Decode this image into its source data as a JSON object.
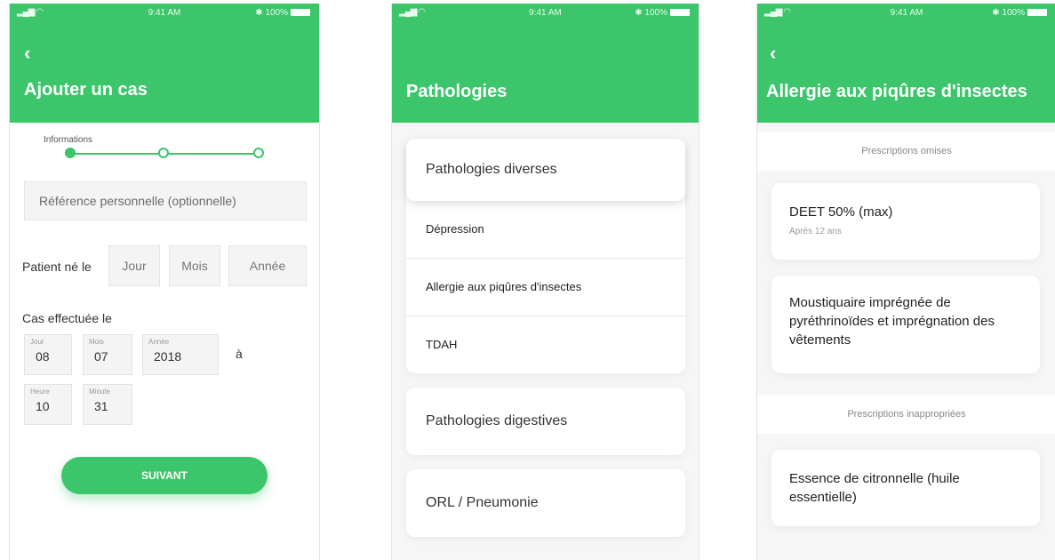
{
  "status": {
    "time": "9:41 AM",
    "battery": "100%"
  },
  "screen1": {
    "title": "Ajouter un cas",
    "step_label": "Informations",
    "ref_placeholder": "Référence personnelle (optionnelle)",
    "born_label": "Patient né le",
    "born_fields": [
      "Jour",
      "Mois",
      "Année"
    ],
    "case_label": "Cas effectuée le",
    "date": [
      {
        "caption": "Jour",
        "value": "08"
      },
      {
        "caption": "Mois",
        "value": "07"
      },
      {
        "caption": "Année",
        "value": "2018"
      }
    ],
    "a_label": "à",
    "time": [
      {
        "caption": "Heure",
        "value": "10"
      },
      {
        "caption": "Minute",
        "value": "31"
      }
    ],
    "button": "SUIVANT"
  },
  "screen2": {
    "title": "Pathologies",
    "groups": [
      {
        "label": "Pathologies diverses",
        "items": [
          "Dépression",
          "Allergie aux piqûres d'insectes",
          "TDAH"
        ]
      },
      {
        "label": "Pathologies digestives",
        "items": []
      },
      {
        "label": "ORL / Pneumonie",
        "items": []
      }
    ]
  },
  "screen3": {
    "title": "Allergie aux piqûres d'insectes",
    "section1": "Prescriptions omises",
    "card1_title": "DEET 50% (max)",
    "card1_sub": "Après 12 ans",
    "card2_title": "Moustiquaire imprégnée de pyréthrinoïdes et imprégnation des vêtements",
    "section2": "Prescriptions inappropriées",
    "card3_title": "Essence de citronnelle (huile essentielle)"
  },
  "colors": {
    "accent": "#3cc56a"
  }
}
